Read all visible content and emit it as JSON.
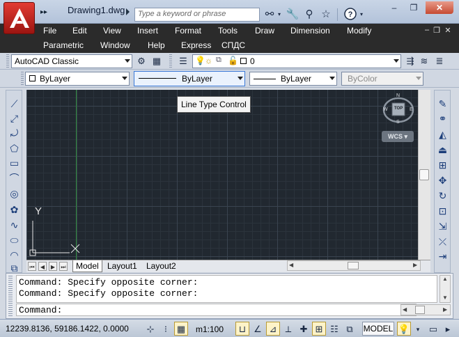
{
  "window": {
    "doc_title": "Drawing1.dwg",
    "search_placeholder": "Type a keyword or phrase",
    "quick_access": "▸▸",
    "minimize": "–",
    "restore": "❐",
    "close": "✕"
  },
  "menu_row1": [
    "File",
    "Edit",
    "View",
    "Insert",
    "Format",
    "Tools",
    "Draw",
    "Dimension",
    "Modify"
  ],
  "menu_row2": [
    "Parametric",
    "Window",
    "Help",
    "Express",
    "СПДС"
  ],
  "workspace": {
    "value": "AutoCAD Classic"
  },
  "layer": {
    "value": "0"
  },
  "properties": {
    "color_value": "ByLayer",
    "linetype_value": "ByLayer",
    "lineweight_value": "ByLayer",
    "plotstyle_value": "ByColor"
  },
  "tooltip": {
    "text": "Line Type Control"
  },
  "viewcube": {
    "top": "TOP",
    "north": "N",
    "south": "S",
    "east": "E",
    "west": "W",
    "wcs": "WCS"
  },
  "ucs": {
    "y_label": "Y",
    "x_label": "X"
  },
  "layout_tabs": [
    "Model",
    "Layout1",
    "Layout2"
  ],
  "command": {
    "history": [
      "Command: Specify opposite corner:",
      "Command: Specify opposite corner:"
    ],
    "prompt": "Command:"
  },
  "status": {
    "coordinates": "12239.8136, 59186.1422, 0.0000",
    "scale": "m1:100",
    "model": "MODEL"
  }
}
